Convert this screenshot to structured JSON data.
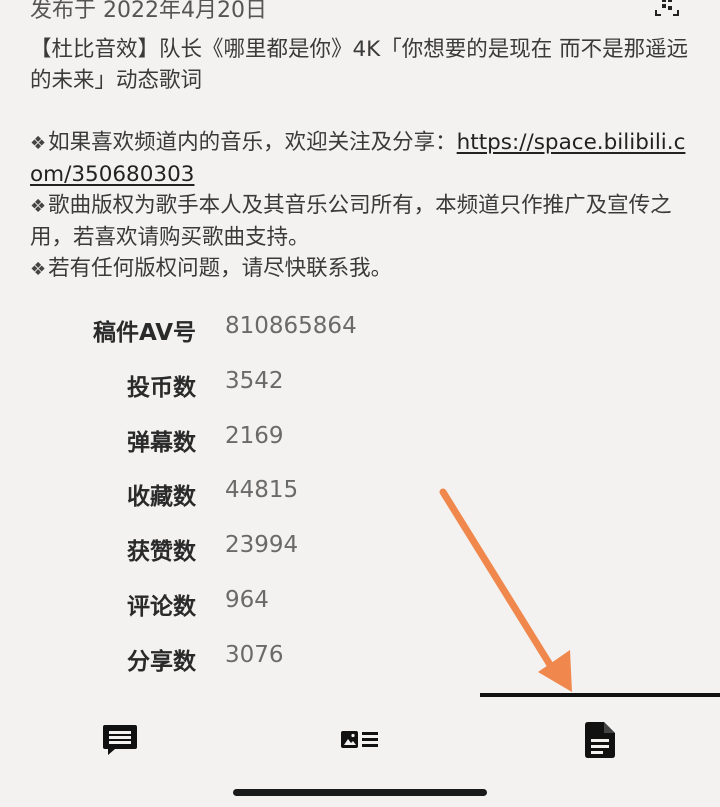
{
  "publish": {
    "text": "发布于 2022年4月20日"
  },
  "description": {
    "title_line": "【杜比音效】队长《哪里都是你》4K「你想要的是现在 而不是那遥远的未来」动态歌词",
    "bullet_glyph": "❖",
    "line1_prefix": "如果喜欢频道内的音乐，欢迎关注及分享：",
    "line1_link": "https://space.bilibili.com/350680303",
    "line2": "歌曲版权为歌手本人及其音乐公司所有，本频道只作推广及宣传之用，若喜欢请购买歌曲支持。",
    "line3": "若有任何版权问题，请尽快联系我。"
  },
  "stats": [
    {
      "label": "稿件AV号",
      "value": "810865864"
    },
    {
      "label": "投币数",
      "value": "3542"
    },
    {
      "label": "弹幕数",
      "value": "2169"
    },
    {
      "label": "收藏数",
      "value": "44815"
    },
    {
      "label": "获赞数",
      "value": "23994"
    },
    {
      "label": "评论数",
      "value": "964"
    },
    {
      "label": "分享数",
      "value": "3076"
    }
  ],
  "tabs": [
    {
      "icon": "comment-icon",
      "active": false
    },
    {
      "icon": "media-list-icon",
      "active": false
    },
    {
      "icon": "document-icon",
      "active": true
    }
  ],
  "colors": {
    "background": "#f3f2f0",
    "annotation_arrow": "#f0884e",
    "active_indicator": "#111111"
  },
  "icons": {
    "top_right": "qr-code-icon"
  }
}
